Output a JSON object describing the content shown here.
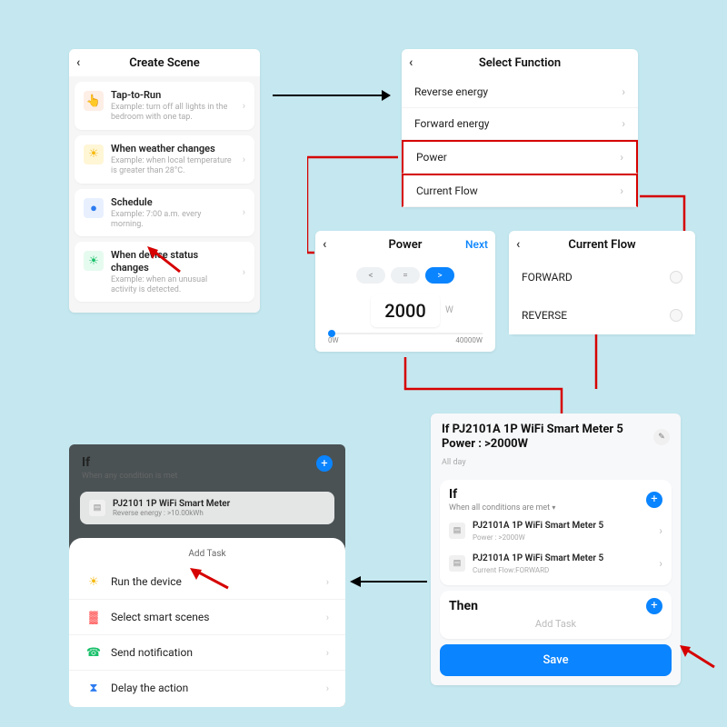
{
  "p1": {
    "title": "Create Scene",
    "items": [
      {
        "icon": "👆",
        "iconBg": "#fdeee6",
        "title": "Tap-to-Run",
        "sub": "Example: turn off all lights in the bedroom with one tap."
      },
      {
        "icon": "☀",
        "iconBg": "#fff6d6",
        "iconColor": "#f6b80b",
        "title": "When weather changes",
        "sub": "Example: when local temperature is greater than 28°C."
      },
      {
        "icon": "●",
        "iconBg": "#e8f0ff",
        "iconColor": "#2d7bf0",
        "title": "Schedule",
        "sub": "Example: 7:00 a.m. every morning."
      },
      {
        "icon": "☀",
        "iconBg": "#e6fbef",
        "iconColor": "#19c06a",
        "title": "When device status changes",
        "sub": "Example: when an unusual activity is detected."
      }
    ]
  },
  "p2": {
    "title": "Select Function",
    "rows": [
      "Reverse energy",
      "Forward energy",
      "Power",
      "Current Flow"
    ]
  },
  "p3": {
    "title": "Power",
    "next": "Next",
    "ops": [
      "<",
      "=",
      ">"
    ],
    "value": "2000",
    "unit": "W",
    "min": "0W",
    "max": "40000W"
  },
  "p4": {
    "title": "Current Flow",
    "opts": [
      "FORWARD",
      "REVERSE"
    ]
  },
  "p5": {
    "title": "If PJ2101A 1P WiFi Smart Meter  5 Power : >2000W",
    "allday": "All day",
    "if_label": "If",
    "if_sub": "When all conditions are met",
    "conds": [
      {
        "name": "PJ2101A 1P WiFi Smart Meter 5",
        "detail": "Power : >2000W"
      },
      {
        "name": "PJ2101A 1P WiFi Smart Meter 5",
        "detail": "Current Flow:FORWARD"
      }
    ],
    "then_label": "Then",
    "addtask": "Add Task",
    "save": "Save"
  },
  "p6": {
    "if_label": "If",
    "if_sub": "When any condition is met",
    "cond_name": "PJ2101 1P WiFi Smart Meter",
    "cond_detail": "Reverse energy : >10.00kWh",
    "sheet_title": "Add Task",
    "rows": [
      {
        "icon": "☀",
        "color": "#f6b80b",
        "label": "Run the device"
      },
      {
        "icon": "▓",
        "color": "#ff5c5c",
        "label": "Select smart scenes"
      },
      {
        "icon": "☎",
        "color": "#19c06a",
        "label": "Send notification"
      },
      {
        "icon": "⧗",
        "color": "#2d7bf0",
        "label": "Delay the action"
      }
    ]
  }
}
